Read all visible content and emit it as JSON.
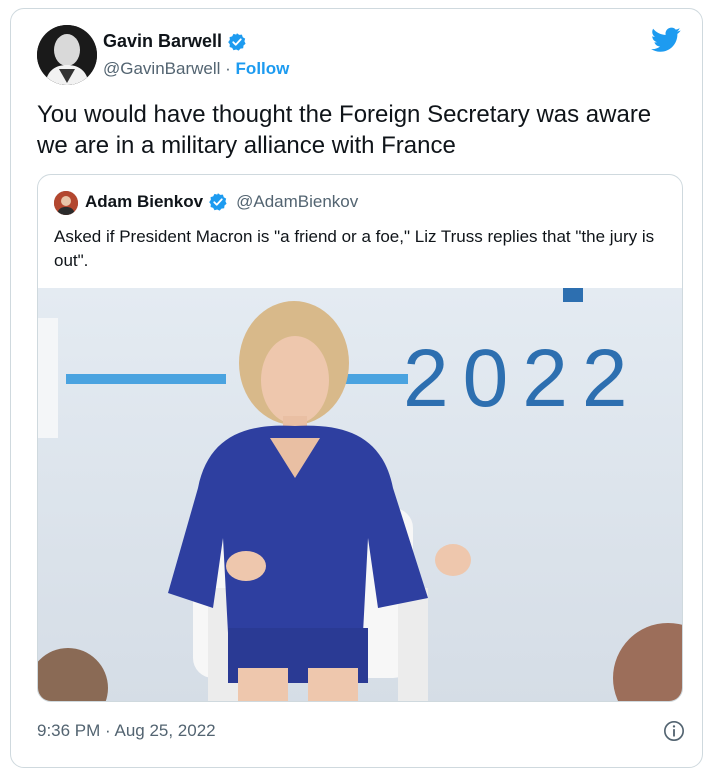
{
  "author": {
    "name": "Gavin Barwell",
    "handle": "@GavinBarwell",
    "separator": "·",
    "follow_label": "Follow"
  },
  "tweet": {
    "text": "You would have thought the Foreign Secretary was aware we are in a military alliance with France",
    "timestamp": "9:36 PM · Aug 25, 2022"
  },
  "quoted": {
    "name": "Adam Bienkov",
    "handle": "@AdamBienkov",
    "text": "Asked if President Macron is \"a friend or a foe,\" Liz Truss replies that \"the jury is out\".",
    "media_text": "2022"
  },
  "icons": {
    "verified": "verified-badge-icon",
    "platform": "twitter-bird-icon",
    "info": "info-icon"
  },
  "colors": {
    "accent": "#1d9bf0",
    "secondary_text": "#536471",
    "border": "#cfd9de"
  }
}
